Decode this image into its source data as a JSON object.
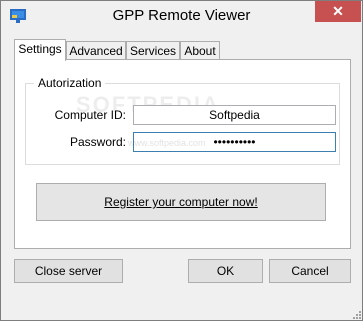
{
  "window": {
    "title": "GPP Remote Viewer",
    "close_glyph": "✕",
    "icon": "remote-viewer-app-icon"
  },
  "tabs": [
    {
      "label": "Settings",
      "active": true
    },
    {
      "label": "Advanced",
      "active": false
    },
    {
      "label": "Services",
      "active": false
    },
    {
      "label": "About",
      "active": false
    }
  ],
  "authorization": {
    "group_title": "Autorization",
    "computer_id_label": "Computer ID:",
    "computer_id_value": "Softpedia",
    "password_label": "Password:",
    "password_value": "••••••••••"
  },
  "watermark": {
    "text": "SOFTPEDIA",
    "sub": "www.softpedia.com"
  },
  "register_label": "Register your computer now!",
  "buttons": {
    "close_server": "Close server",
    "ok": "OK",
    "cancel": "Cancel"
  },
  "colors": {
    "close_button_bg": "#c75050",
    "focus_border": "#3c7fb1",
    "app_icon_blue": "#2b6cc4"
  }
}
